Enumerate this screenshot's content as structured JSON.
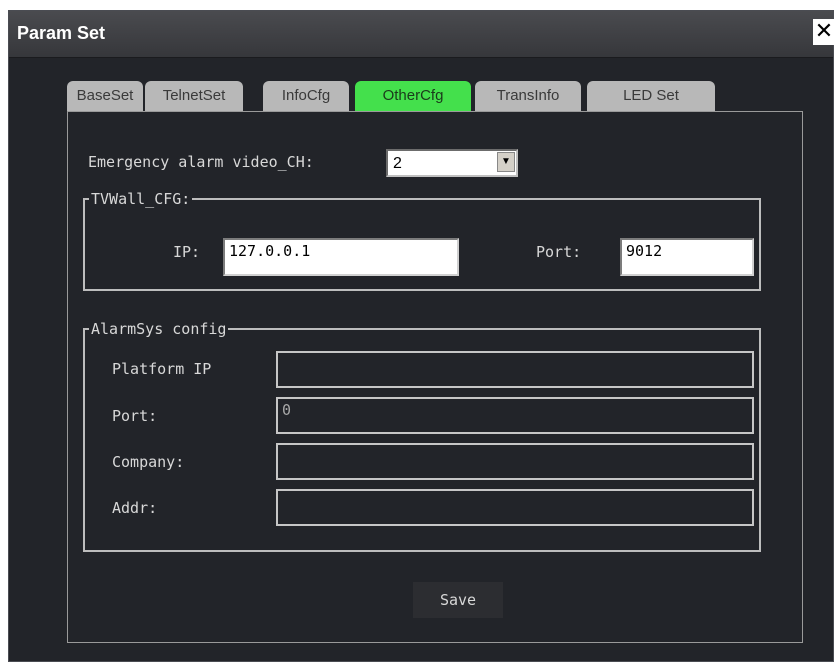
{
  "window": {
    "title": "Param Set",
    "close_glyph": "✕"
  },
  "tabs": [
    {
      "label": "BaseSet",
      "active": false
    },
    {
      "label": "TelnetSet",
      "active": false
    },
    {
      "label": "InfoCfg",
      "active": false
    },
    {
      "label": "OtherCfg",
      "active": true
    },
    {
      "label": "TransInfo",
      "active": false
    },
    {
      "label": "LED Set",
      "active": false
    }
  ],
  "emergency": {
    "label": "Emergency alarm video_CH:",
    "value": "2"
  },
  "tvwall": {
    "legend": "TVWall_CFG:",
    "ip_label": "IP:",
    "ip_value": "127.0.0.1",
    "port_label": "Port:",
    "port_value": "9012"
  },
  "alarmsys": {
    "legend": "AlarmSys config",
    "platform_ip_label": "Platform IP",
    "platform_ip_value": "",
    "port_label": "Port:",
    "port_value": "0",
    "company_label": "Company:",
    "company_value": "",
    "addr_label": "Addr:",
    "addr_value": ""
  },
  "save_label": "Save",
  "colors": {
    "active_tab": "#44e04c",
    "inactive_tab": "#b8b8b8",
    "background": "#222429"
  }
}
